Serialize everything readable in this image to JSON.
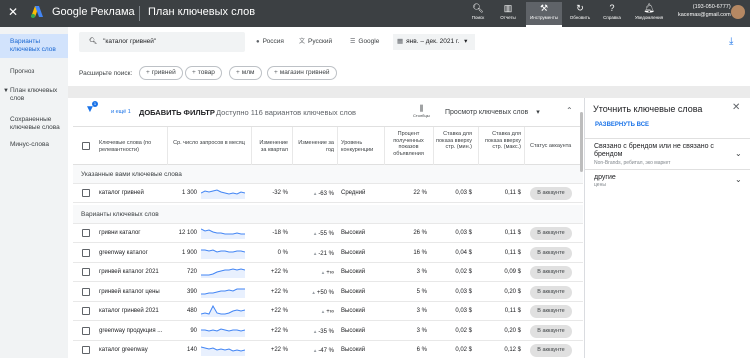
{
  "app": {
    "brand": "Google Реклама",
    "page_title": "План ключевых слов",
    "close_glyph": "✕",
    "toolbar": [
      {
        "label": "Поиск",
        "icon": "search-icon"
      },
      {
        "label": "Отчеты",
        "icon": "reports-icon"
      },
      {
        "label": "Инструменты",
        "icon": "tools-icon"
      },
      {
        "label": "Обновить",
        "icon": "refresh-icon"
      },
      {
        "label": "Справка",
        "icon": "help-icon"
      },
      {
        "label": "Уведомления",
        "icon": "bell-icon"
      }
    ],
    "account_id": "(193-050-6777)",
    "account_email": "kacemas@gmail.com"
  },
  "sidebar": {
    "items": [
      {
        "label": "Варианты ключевых слов",
        "active": true
      },
      {
        "label": "Прогноз",
        "active": false
      },
      {
        "label": "План ключевых слов",
        "active": false,
        "caret": "▼"
      },
      {
        "label": "Сохраненные ключевые слова",
        "active": false
      },
      {
        "label": "Минус-слова",
        "active": false
      }
    ]
  },
  "search": {
    "query": "\"каталог гривней\"",
    "location": "Россия",
    "language": "Русский",
    "network": "Google",
    "date_range": "янв. – дек. 2021 г."
  },
  "expand": {
    "label": "Расширьте поиск:",
    "pills": [
      "гривней",
      "товар",
      "млм",
      "магазин гривней"
    ]
  },
  "filterbar": {
    "badge": "1",
    "more": "и ещё 1",
    "add_filter": "ДОБАВИТЬ ФИЛЬТР",
    "available": "Доступно 116 вариантов ключевых слов",
    "columns_label": "Столбцы",
    "view": "Просмотр ключевых слов"
  },
  "table": {
    "headers": {
      "keyword": "Ключевые слова (по релевантности)",
      "avg": "Ср. число запросов в месяц",
      "q_change": "Изменение за квартал",
      "y_change": "Изменение за год",
      "competition": "Уровень конкуренции",
      "impr_share": "Процент полученных показов объявления",
      "bid_low": "Ставка для показа вверху стр. (мин.)",
      "bid_high": "Ставка для показа вверху стр. (макс.)",
      "status": "Статус аккаунта"
    },
    "group_provided": "Указанные вами ключевые слова",
    "group_ideas": "Варианты ключевых слов",
    "provided_rows": [
      {
        "keyword": "каталог гривней",
        "avg": "1 300",
        "q": "-32 %",
        "y": "-63 %",
        "comp": "Средний",
        "share": "22 %",
        "low": "0,03 $",
        "high": "0,11 $",
        "status": "В аккаунте",
        "trend": [
          6,
          4,
          5,
          4,
          3,
          5,
          6,
          7,
          6,
          7,
          5,
          6
        ]
      }
    ],
    "idea_rows": [
      {
        "keyword": "гривни каталог",
        "avg": "12 100",
        "q": "-18 %",
        "y": "-55 %",
        "comp": "Высокий",
        "share": "26 %",
        "low": "0,03 $",
        "high": "0,11 $",
        "status": "В аккаунте",
        "trend": [
          2,
          4,
          3,
          5,
          6,
          6,
          7,
          7,
          7,
          6,
          7,
          7
        ]
      },
      {
        "keyword": "greenway каталог",
        "avg": "1 900",
        "q": "0 %",
        "y": "-21 %",
        "comp": "Высокий",
        "share": "16 %",
        "low": "0,04 $",
        "high": "0,11 $",
        "status": "В аккаунте",
        "trend": [
          3,
          3,
          4,
          3,
          5,
          4,
          4,
          5,
          5,
          4,
          4,
          5
        ]
      },
      {
        "keyword": "гринвей каталог 2021",
        "avg": "720",
        "q": "+22 %",
        "y": "+∞",
        "comp": "Высокий",
        "share": "3 %",
        "low": "0,02 $",
        "high": "0,09 $",
        "status": "В аккаунте",
        "trend": [
          9,
          9,
          9,
          8,
          6,
          5,
          4,
          4,
          3,
          4,
          3,
          4
        ]
      },
      {
        "keyword": "гринвей каталог цены",
        "avg": "390",
        "q": "+22 %",
        "y": "+50 %",
        "comp": "Высокий",
        "share": "5 %",
        "low": "0,03 $",
        "high": "0,20 $",
        "status": "В аккаунте",
        "trend": [
          8,
          8,
          7,
          7,
          6,
          5,
          5,
          4,
          5,
          3,
          3,
          3
        ]
      },
      {
        "keyword": "каталог гринвей 2021",
        "avg": "480",
        "q": "+22 %",
        "y": "+∞",
        "comp": "Высокий",
        "share": "3 %",
        "low": "0,03 $",
        "high": "0,11 $",
        "status": "В аккаунте",
        "trend": [
          9,
          8,
          9,
          1,
          8,
          9,
          9,
          8,
          6,
          5,
          6,
          5
        ]
      },
      {
        "keyword": "greenway продукция ...",
        "avg": "90",
        "q": "+22 %",
        "y": "-35 %",
        "comp": "Высокий",
        "share": "3 %",
        "low": "0,02 $",
        "high": "0,20 $",
        "status": "В аккаунте",
        "trend": [
          5,
          5,
          6,
          5,
          6,
          4,
          5,
          6,
          5,
          5,
          6,
          5
        ]
      },
      {
        "keyword": "каталог greenway",
        "avg": "140",
        "q": "+22 %",
        "y": "-47 %",
        "comp": "Высокий",
        "share": "6 %",
        "low": "0,02 $",
        "high": "0,12 $",
        "status": "В аккаунте",
        "trend": [
          3,
          4,
          5,
          4,
          6,
          5,
          6,
          5,
          7,
          6,
          7,
          6
        ]
      }
    ]
  },
  "panel": {
    "title": "Уточнить ключевые слова",
    "expand_all": "РАЗВЕРНУТЬ ВСЕ",
    "groups": [
      {
        "title": "Связано с брендом или не связано с брендом",
        "sub": "Non-Brands, ребитал, эко маркет"
      },
      {
        "title": "другие",
        "sub": "цены"
      }
    ]
  },
  "colors": {
    "topbar": "#3c4043",
    "accent": "#1a73e8",
    "sparkline": "#4285f4",
    "sidebar_active": "#d2e3fc"
  }
}
